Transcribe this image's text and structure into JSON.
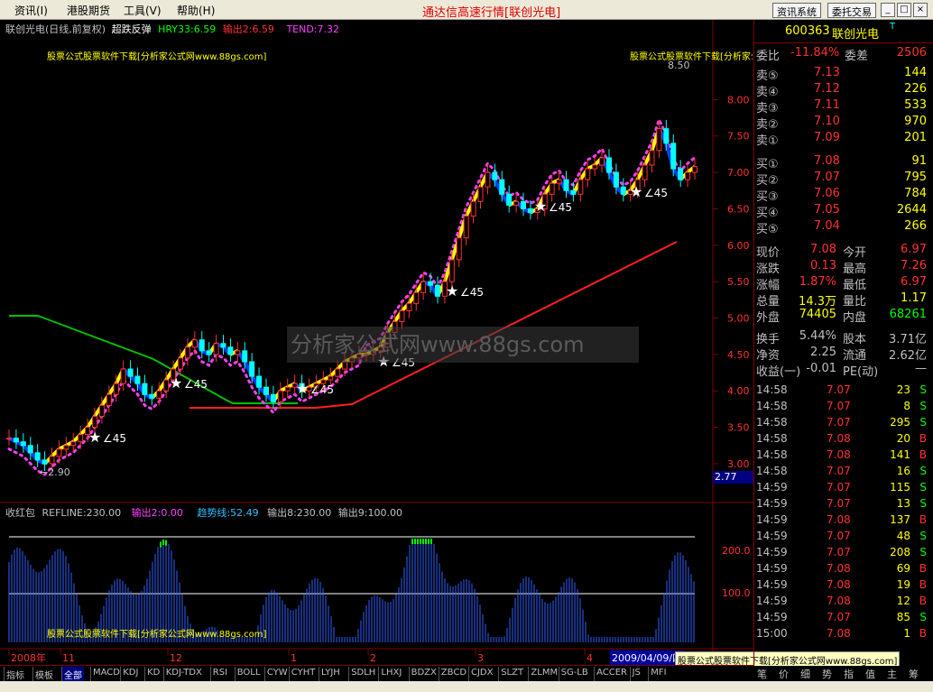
{
  "menu": {
    "items": [
      "资讯(I)",
      "港股期货",
      "工具(V)",
      "帮助(H)"
    ]
  },
  "app_title": "通达信高速行情[联创光电]",
  "toolbar": {
    "news": "资讯系统",
    "order": "委托交易"
  },
  "window_buttons": [
    "_",
    "□",
    "×"
  ],
  "main_legend": {
    "name": "联创光电(日线,前复权)",
    "indicator": "超跌反弹",
    "hry": "HRY33:6.59",
    "out2": "输出2:6.59",
    "tend": "TEND:7.32"
  },
  "watermark": "股票公式股票软件下载[分析家公式网www.88gs.com]",
  "watermark_center": "分析家公式网www.88gs.com",
  "price_axis": [
    {
      "v": 8.0
    },
    {
      "v": 7.5
    },
    {
      "v": 7.0
    },
    {
      "v": 6.5
    },
    {
      "v": 6.0
    },
    {
      "v": 5.5
    },
    {
      "v": 5.0
    },
    {
      "v": 4.5
    },
    {
      "v": 4.0
    },
    {
      "v": 3.5
    },
    {
      "v": 3.0
    }
  ],
  "price_axis_labels": [
    "8.00",
    "7.50",
    "7.00",
    "6.50",
    "6.00",
    "5.50",
    "5.00",
    "4.50",
    "4.00",
    "3.50",
    "3.00"
  ],
  "current_price_tag": "2.77",
  "high_mark": "8.50",
  "low_mark": "←2.90",
  "angle_labels": [
    "∠45",
    "∠45",
    "∠45",
    "∠45",
    "∠45",
    "∠45",
    "∠45"
  ],
  "sub_legend": {
    "name": "收红包",
    "refline": "REFLINE:230.00",
    "out2": "输出2:0.00",
    "trend": "趋势线:52.49",
    "out8": "输出8:230.00",
    "out9": "输出9:100.00"
  },
  "sub_axis": [
    "200.0",
    "100.0"
  ],
  "date_axis": [
    "2008年",
    "11",
    "12",
    "1",
    "2",
    "3",
    "4"
  ],
  "date_cursor": "2009/04/09/四",
  "bottom_tabs": [
    "指标",
    "模板",
    "全部",
    "MACD",
    "KDJ",
    "KD",
    "KDJ-TDX",
    "RSI",
    "BOLL",
    "CYW",
    "CYHT",
    "LYJH",
    "SDLH",
    "LHXJ",
    "BDZX",
    "ZBCD",
    "CJDX",
    "SLZT",
    "ZLMM",
    "SG-LB",
    "ACCER",
    "JS",
    "MFI"
  ],
  "stock": {
    "code": "600363",
    "name": "联创光电",
    "suffix": "T"
  },
  "order_book": {
    "ratio_label": "委比",
    "ratio_val": "-11.84%",
    "diff_label": "委差",
    "diff_val": "2506",
    "asks": [
      {
        "l": "卖⑤",
        "p": "7.13",
        "v": "144"
      },
      {
        "l": "卖④",
        "p": "7.12",
        "v": "226"
      },
      {
        "l": "卖③",
        "p": "7.11",
        "v": "533"
      },
      {
        "l": "卖②",
        "p": "7.10",
        "v": "970"
      },
      {
        "l": "卖①",
        "p": "7.09",
        "v": "201"
      }
    ],
    "bids": [
      {
        "l": "买①",
        "p": "7.08",
        "v": "91"
      },
      {
        "l": "买②",
        "p": "7.07",
        "v": "795"
      },
      {
        "l": "买③",
        "p": "7.06",
        "v": "784"
      },
      {
        "l": "买④",
        "p": "7.05",
        "v": "2644"
      },
      {
        "l": "买⑤",
        "p": "7.04",
        "v": "266"
      }
    ]
  },
  "quote": [
    {
      "l1": "现价",
      "v1": "7.08",
      "l2": "今开",
      "v2": "6.97"
    },
    {
      "l1": "涨跌",
      "v1": "0.13",
      "l2": "最高",
      "v2": "7.26"
    },
    {
      "l1": "涨幅",
      "v1": "1.87%",
      "l2": "最低",
      "v2": "6.97"
    },
    {
      "l1": "总量",
      "v1": "14.3万",
      "l2": "量比",
      "v2": "1.17"
    },
    {
      "l1": "外盘",
      "v1": "74405",
      "l2": "内盘",
      "v2": "68261"
    }
  ],
  "fundamentals": [
    {
      "l1": "换手",
      "v1": "5.44%",
      "l2": "股本",
      "v2": "3.71亿"
    },
    {
      "l1": "净资",
      "v1": "2.25",
      "l2": "流通",
      "v2": "2.62亿"
    },
    {
      "l1": "收益(一)",
      "v1": "-0.01",
      "l2": "PE(动)",
      "v2": "—"
    }
  ],
  "ticks": [
    {
      "t": "14:58",
      "p": "7.07",
      "v": "23",
      "s": "S"
    },
    {
      "t": "14:58",
      "p": "7.07",
      "v": "8",
      "s": "S"
    },
    {
      "t": "14:58",
      "p": "7.07",
      "v": "295",
      "s": "S"
    },
    {
      "t": "14:58",
      "p": "7.08",
      "v": "20",
      "s": "B"
    },
    {
      "t": "14:58",
      "p": "7.08",
      "v": "141",
      "s": "B"
    },
    {
      "t": "14:58",
      "p": "7.07",
      "v": "16",
      "s": "S"
    },
    {
      "t": "14:59",
      "p": "7.07",
      "v": "115",
      "s": "S"
    },
    {
      "t": "14:59",
      "p": "7.07",
      "v": "13",
      "s": "S"
    },
    {
      "t": "14:59",
      "p": "7.08",
      "v": "137",
      "s": "B"
    },
    {
      "t": "14:59",
      "p": "7.07",
      "v": "48",
      "s": "S"
    },
    {
      "t": "14:59",
      "p": "7.07",
      "v": "208",
      "s": "S"
    },
    {
      "t": "14:59",
      "p": "7.08",
      "v": "69",
      "s": "B"
    },
    {
      "t": "14:59",
      "p": "7.08",
      "v": "19",
      "s": "B"
    },
    {
      "t": "14:59",
      "p": "7.08",
      "v": "12",
      "s": "B"
    },
    {
      "t": "14:59",
      "p": "7.07",
      "v": "85",
      "s": "S"
    },
    {
      "t": "15:00",
      "p": "7.08",
      "v": "1",
      "s": "B"
    }
  ],
  "right_tabs": [
    "笔",
    "价",
    "细",
    "势",
    "指",
    "值",
    "主",
    "筹"
  ],
  "chart_data": {
    "type": "candlestick",
    "y_range": [
      2.7,
      8.9
    ],
    "closes": [
      3.35,
      3.3,
      3.25,
      3.15,
      3.05,
      3.0,
      3.1,
      3.2,
      3.25,
      3.3,
      3.4,
      3.5,
      3.65,
      3.8,
      3.95,
      4.1,
      4.3,
      4.2,
      4.1,
      3.95,
      3.9,
      4.0,
      4.15,
      4.3,
      4.45,
      4.6,
      4.7,
      4.55,
      4.5,
      4.65,
      4.6,
      4.5,
      4.55,
      4.4,
      4.2,
      4.05,
      3.95,
      3.85,
      4.0,
      4.05,
      4.1,
      4.0,
      4.05,
      4.1,
      4.15,
      4.2,
      4.3,
      4.4,
      4.45,
      4.5,
      4.5,
      4.55,
      4.6,
      4.8,
      4.95,
      5.1,
      5.2,
      5.35,
      5.5,
      5.45,
      5.3,
      5.5,
      5.8,
      6.1,
      6.4,
      6.6,
      6.8,
      7.0,
      6.9,
      6.7,
      6.55,
      6.6,
      6.5,
      6.45,
      6.5,
      6.7,
      6.85,
      6.9,
      6.75,
      6.7,
      6.9,
      7.05,
      7.1,
      7.2,
      7.0,
      6.8,
      6.7,
      6.75,
      6.9,
      7.1,
      7.3,
      7.6,
      7.4,
      7.05,
      6.9,
      7.0,
      7.08
    ]
  }
}
